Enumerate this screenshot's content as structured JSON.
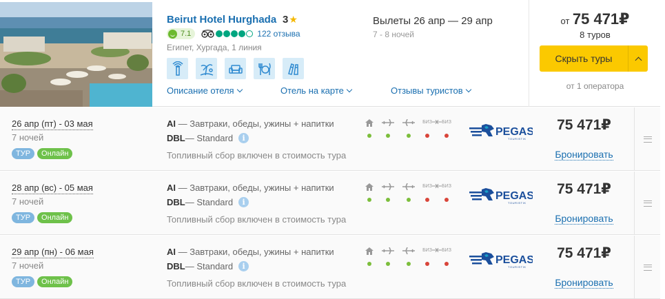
{
  "hotel": {
    "name": "Beirut Hotel Hurghada",
    "stars": "3",
    "score": "7.1",
    "tripadvisor_rating": 4,
    "tripadvisor_max": 5,
    "reviews": "122 отзыва",
    "location": "Египет, Хургада, 1 линия",
    "amenity_icons": [
      "wifi-icon",
      "beach-icon",
      "sofa-icon",
      "restaurant-icon",
      "diving-icon"
    ],
    "links": {
      "description": "Описание отеля",
      "map": "Отель на карте",
      "reviews": "Отзывы туристов"
    },
    "departures": "Вылеты 26 апр — 29 апр",
    "nights_range": "7 - 8 ночей",
    "price_prefix": "от",
    "price": "75 471₽",
    "tours_count": "8 туров",
    "hide_button": "Скрыть туры",
    "operators_count": "от 1 оператора"
  },
  "colors": {
    "link": "#1a6fb0",
    "button": "#fbc900",
    "badge_tour": "#7fb6df",
    "badge_online": "#6ec14a",
    "dot_included": "#7cbe3c",
    "dot_excluded": "#d9453a"
  },
  "services_legend": [
    "hotel-icon",
    "flight-there-icon",
    "flight-back-icon",
    "business-there-icon",
    "business-back-icon"
  ],
  "tours": [
    {
      "date": "26 апр (пт) - 03 мая",
      "nights": "7 ночей",
      "badge_tour": "ТУР",
      "badge_online": "Онлайн",
      "meal_code": "AI",
      "meal": " — Завтраки, обеды, ужины + напитки",
      "room_code": "DBL",
      "room": " — Standard",
      "fee_note": "Топливный сбор включен в стоимость тура",
      "services": [
        "included",
        "included",
        "included",
        "excluded",
        "excluded"
      ],
      "operator": "PEGAS",
      "operator_sub": "TOURISTIK",
      "price": "75 471₽",
      "book": "Бронировать"
    },
    {
      "date": "28 апр (вс) - 05 мая",
      "nights": "7 ночей",
      "badge_tour": "ТУР",
      "badge_online": "Онлайн",
      "meal_code": "AI",
      "meal": " — Завтраки, обеды, ужины + напитки",
      "room_code": "DBL",
      "room": " — Standard",
      "fee_note": "Топливный сбор включен в стоимость тура",
      "services": [
        "included",
        "included",
        "included",
        "excluded",
        "excluded"
      ],
      "operator": "PEGAS",
      "operator_sub": "TOURISTIK",
      "price": "75 471₽",
      "book": "Бронировать"
    },
    {
      "date": "29 апр (пн) - 06 мая",
      "nights": "7 ночей",
      "badge_tour": "ТУР",
      "badge_online": "Онлайн",
      "meal_code": "AI",
      "meal": " — Завтраки, обеды, ужины + напитки",
      "room_code": "DBL",
      "room": " — Standard",
      "fee_note": "Топливный сбор включен в стоимость тура",
      "services": [
        "included",
        "included",
        "included",
        "excluded",
        "excluded"
      ],
      "operator": "PEGAS",
      "operator_sub": "TOURISTIK",
      "price": "75 471₽",
      "book": "Бронировать"
    }
  ]
}
